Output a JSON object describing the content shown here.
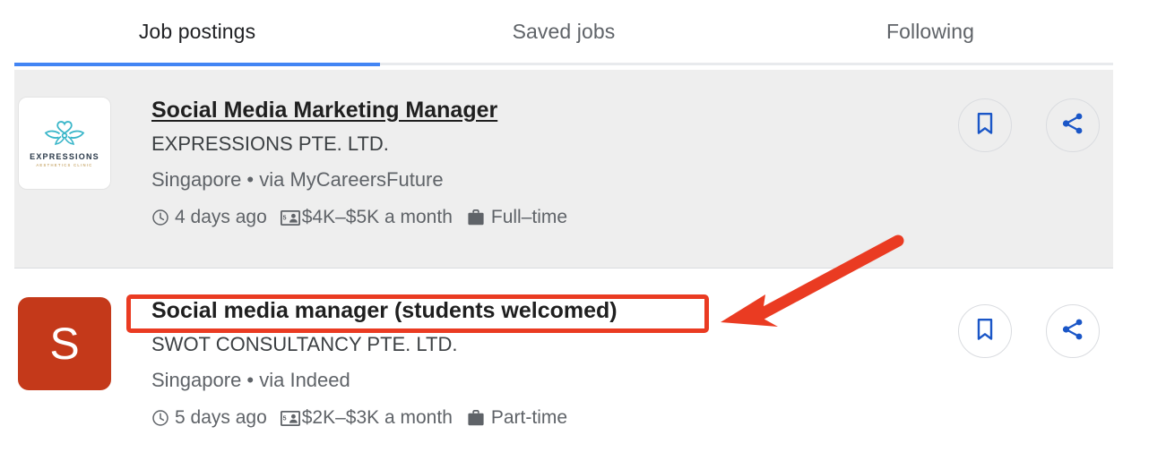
{
  "tabs": [
    {
      "label": "Job postings",
      "active": true
    },
    {
      "label": "Saved jobs",
      "active": false
    },
    {
      "label": "Following",
      "active": false
    }
  ],
  "colors": {
    "tab_indicator": "#4285f4",
    "selected_card_bg": "#eeeeee",
    "action_icon_blue": "#1a56c7",
    "annotation_red": "#ea3b22",
    "swot_logo_bg": "#c4391a",
    "expressions_logo_teal": "#3ab6c9"
  },
  "jobs": [
    {
      "title": "Social Media Marketing Manager",
      "company": "EXPRESSIONS PTE. LTD.",
      "location": "Singapore • via MyCareersFuture",
      "posted": "4 days ago",
      "salary": "$4K–$5K a month",
      "job_type": "Full–time",
      "logo_type": "image",
      "logo_word": "EXPRESSIONS",
      "logo_sub": "AESTHETICS CLINIC",
      "selected": true,
      "save_icon": "bookmark-icon",
      "share_icon": "share-icon"
    },
    {
      "title": "Social media manager (students welcomed)",
      "company": "SWOT CONSULTANCY PTE. LTD.",
      "location": "Singapore • via Indeed",
      "posted": "5 days ago",
      "salary": "$2K–$3K a month",
      "job_type": "Part-time",
      "logo_type": "letter",
      "logo_letter": "S",
      "selected": false,
      "save_icon": "bookmark-icon",
      "share_icon": "share-icon"
    }
  ],
  "annotations": {
    "highlight_box_target": "Social media manager (students welcomed)",
    "arrow": "red-arrow-pointing-to-job-title"
  }
}
